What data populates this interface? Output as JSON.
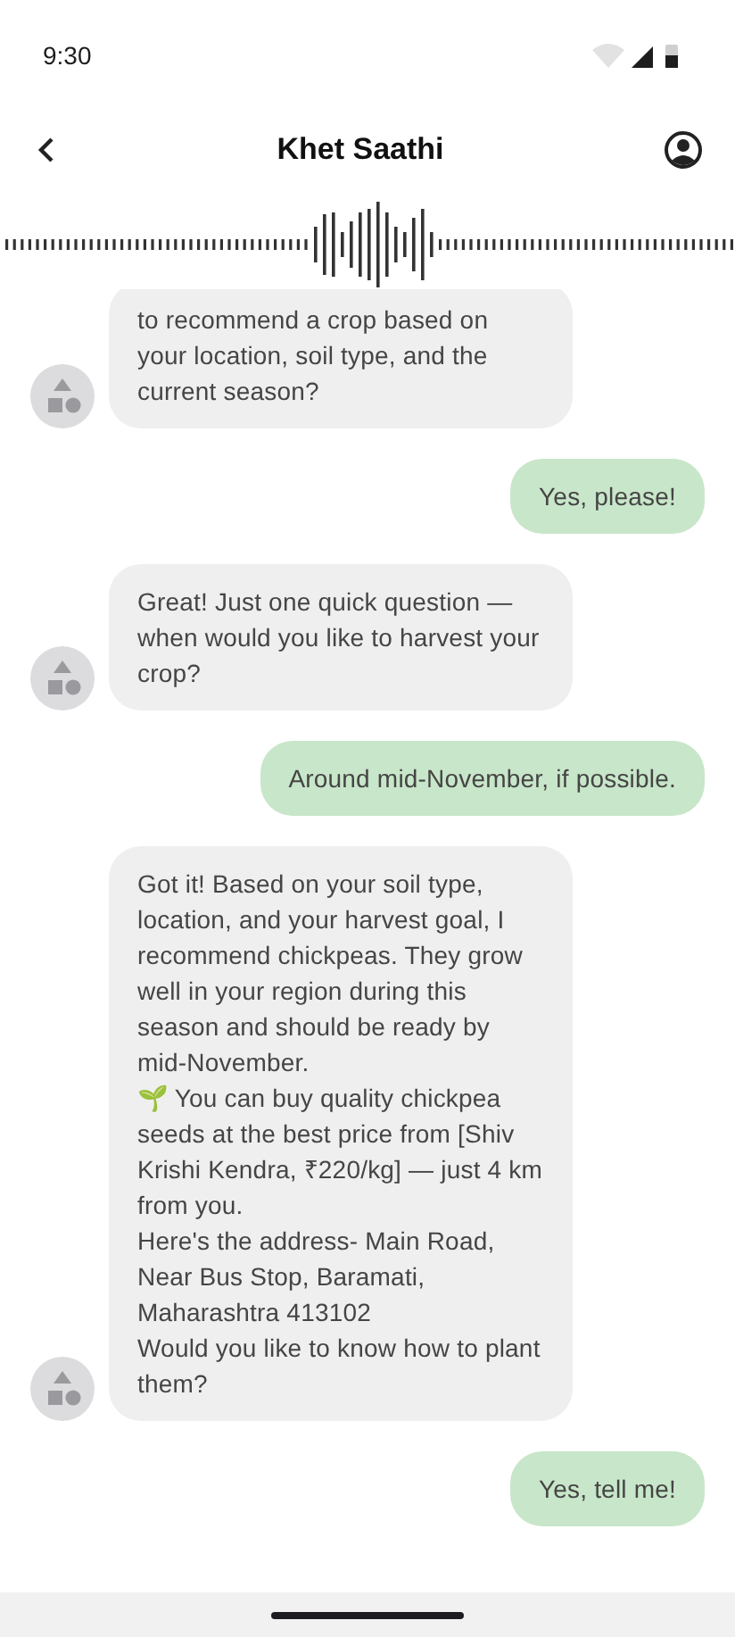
{
  "status_bar": {
    "time": "9:30"
  },
  "app_bar": {
    "title": "Khet Saathi"
  },
  "messages": [
    {
      "kind": "bot",
      "text": "to recommend a crop based on your location, soil type, and the current season?"
    },
    {
      "kind": "user",
      "text": "Yes, please!"
    },
    {
      "kind": "bot",
      "text": "Great! Just one quick question — when would you like to harvest your crop?"
    },
    {
      "kind": "user",
      "text": "Around mid-November, if possible."
    },
    {
      "kind": "bot",
      "text": "Got it! Based on your soil type, location, and your harvest goal, I recommend chickpeas. They grow well in your region during this season and should be ready by mid-November.\n🌱 You can buy quality chickpea seeds at the best price from [Shiv Krishi Kendra, ₹220/kg] — just 4 km from you.\nHere's the address- Main Road, Near Bus Stop, Baramati, Maharashtra 413102\nWould you like to know how to plant them?"
    },
    {
      "kind": "user",
      "text": "Yes, tell me!"
    }
  ]
}
